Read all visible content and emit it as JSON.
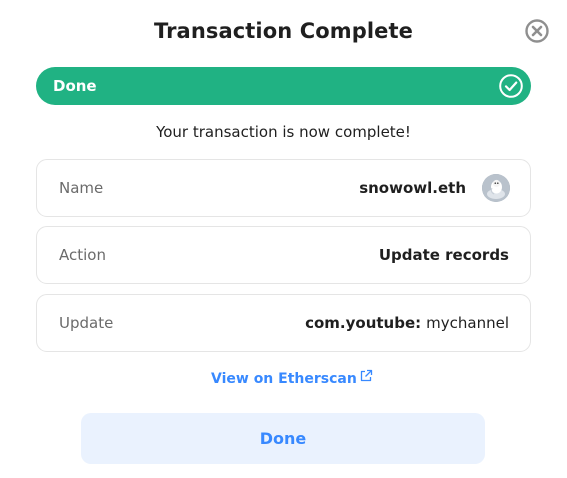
{
  "dialog": {
    "title": "Transaction Complete",
    "close_icon": "close-circle-icon"
  },
  "status": {
    "label": "Done",
    "icon": "check-circle-icon",
    "color": "#20b283"
  },
  "message": "Your transaction is now complete!",
  "details": {
    "name": {
      "label": "Name",
      "value": "snowowl.eth",
      "avatar_icon": "avatar-snowowl"
    },
    "action": {
      "label": "Action",
      "value": "Update records"
    },
    "update": {
      "label": "Update",
      "key": "com.youtube",
      "separator": ":",
      "value": "mychannel"
    }
  },
  "link": {
    "label": "View on Etherscan",
    "icon": "external-link-icon",
    "color": "#3889ff"
  },
  "primary_button": {
    "label": "Done",
    "background": "#eaf2fe"
  }
}
